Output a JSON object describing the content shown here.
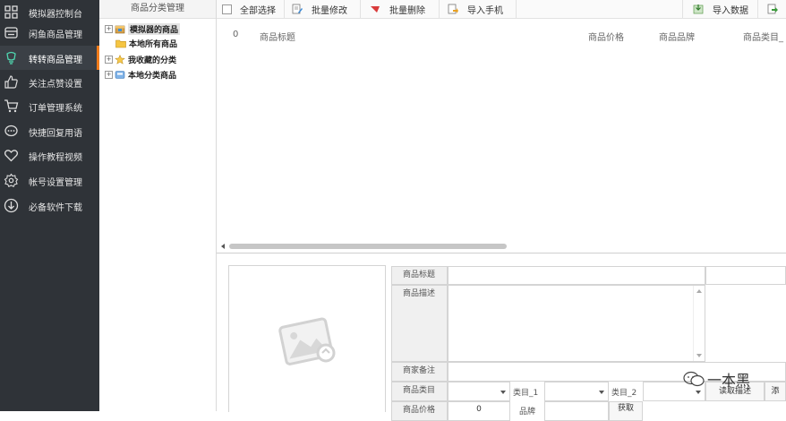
{
  "sidebar": {
    "items": [
      {
        "label": "模拟器控制台",
        "icon": "grid-icon"
      },
      {
        "label": "闲鱼商品管理",
        "icon": "wallet-icon"
      },
      {
        "label": "转转商品管理",
        "icon": "bulb-icon"
      },
      {
        "label": "关注点赞设置",
        "icon": "thumbs-up-icon"
      },
      {
        "label": "订单管理系统",
        "icon": "cart-icon"
      },
      {
        "label": "快捷回复用语",
        "icon": "chat-icon"
      },
      {
        "label": "操作教程视频",
        "icon": "heart-icon"
      },
      {
        "label": "帐号设置管理",
        "icon": "gear-icon"
      },
      {
        "label": "必备软件下载",
        "icon": "download-icon"
      }
    ],
    "active_index": 2,
    "accent_color": "#f07b1a"
  },
  "tree": {
    "header": "商品分类管理",
    "nodes": [
      {
        "label": "模拟器的商品",
        "expander": "+"
      },
      {
        "label": "本地所有商品",
        "expander": ""
      },
      {
        "label": "我收藏的分类",
        "expander": "+"
      },
      {
        "label": "本地分类商品",
        "expander": "+"
      }
    ]
  },
  "toolbar": {
    "select_all": "全部选择",
    "batch_edit": "批量修改",
    "batch_delete": "批量删除",
    "import_phone": "导入手机",
    "import_data": "导入数据"
  },
  "grid": {
    "columns": [
      "0",
      "商品标题",
      "商品价格",
      "商品品牌",
      "商品类目_"
    ]
  },
  "detail": {
    "title_label": "商品标题",
    "desc_label": "商品描述",
    "note_label": "商家备注",
    "category_label": "商品类目",
    "cat1_label": "类目_1",
    "cat2_label": "类目_2",
    "read_desc_button": "读取描述",
    "add_button": "添",
    "price_label": "商品价格",
    "price_value": "0",
    "brand_label": "品牌",
    "fetch_button": "获取"
  },
  "watermark": {
    "text": "一本黑"
  }
}
